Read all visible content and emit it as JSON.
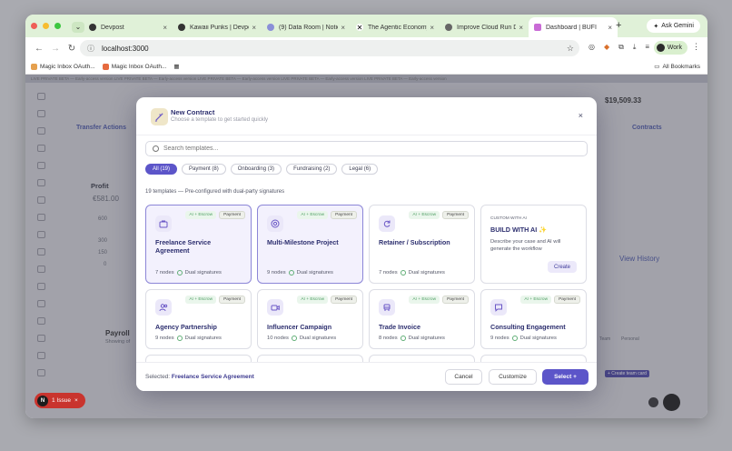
{
  "browser": {
    "tabs": [
      {
        "label": "Devpost",
        "active": false
      },
      {
        "label": "Kawaii Punks | Devpost",
        "active": false
      },
      {
        "label": "(9) Data Room | Notion",
        "active": false
      },
      {
        "label": "The Agentic Economy",
        "active": false
      },
      {
        "label": "Improve Cloud Run Dev",
        "active": false
      },
      {
        "label": "Dashboard | BUFI",
        "active": true
      }
    ],
    "ask_gemini": "Ask Gemini",
    "url": "localhost:3000",
    "profile": "Work",
    "bookmarks": [
      "Magic Inbox OAuth...",
      "Magic Inbox OAuth..."
    ],
    "all_bookmarks": "All Bookmarks"
  },
  "background": {
    "beta_banner": "LIVE PRIVATE BETA — Early-access version      LIVE PRIVATE BETA — Early-access version      LIVE PRIVATE BETA — Early-access version      LIVE PRIVATE BETA — Early-access version      LIVE PRIVATE BETA — Early-access version",
    "balance": "$19,509.33",
    "transfer_actions": "Transfer Actions",
    "contracts": "Contracts",
    "profit": "Profit",
    "profit_value": "€581.00",
    "axis": [
      "600",
      "300",
      "150",
      "0"
    ],
    "view_history": "View History",
    "payroll": "Payroll",
    "payroll_sub": "Showing of",
    "create_team_card": "+ Create team card",
    "tabs_right": [
      "Team",
      "Personal"
    ]
  },
  "modal": {
    "title": "New Contract",
    "subtitle": "Choose a template to get started quickly",
    "close": "×",
    "search_placeholder": "Search templates...",
    "filters": [
      {
        "label": "All (19)",
        "active": true
      },
      {
        "label": "Payment (8)",
        "active": false
      },
      {
        "label": "Onboarding (3)",
        "active": false
      },
      {
        "label": "Fundraising (2)",
        "active": false
      },
      {
        "label": "Legal (6)",
        "active": false
      }
    ],
    "count_note": "19 templates — Pre-configured with dual-party signatures",
    "badge_ai": "AI + Escrow",
    "templates": [
      {
        "title": "Freelance Service Agreement",
        "type": "Payment",
        "nodes": "7 nodes",
        "sig": "Dual signatures",
        "icon": "briefcase-icon",
        "selected": true
      },
      {
        "title": "Multi-Milestone Project",
        "type": "Payment",
        "nodes": "9 nodes",
        "sig": "Dual signatures",
        "icon": "target-icon",
        "selected": true
      },
      {
        "title": "Retainer / Subscription",
        "type": "Payment",
        "nodes": "7 nodes",
        "sig": "Dual signatures",
        "icon": "refresh-icon",
        "selected": false
      },
      {
        "title": "Agency Partnership",
        "type": "Payment",
        "nodes": "9 nodes",
        "sig": "Dual signatures",
        "icon": "users-icon",
        "selected": false
      },
      {
        "title": "Influencer Campaign",
        "type": "Payment",
        "nodes": "10 nodes",
        "sig": "Dual signatures",
        "icon": "video-icon",
        "selected": false
      },
      {
        "title": "Trade Invoice",
        "type": "Payment",
        "nodes": "8 nodes",
        "sig": "Dual signatures",
        "icon": "truck-icon",
        "selected": false
      },
      {
        "title": "Consulting Engagement",
        "type": "Payment",
        "nodes": "9 nodes",
        "sig": "Dual signatures",
        "icon": "message-icon",
        "selected": false
      }
    ],
    "custom": {
      "tag": "CUSTOM WITH AI",
      "title": "BUILD WITH AI ✨",
      "desc": "Describe your case and AI will generate the workflow",
      "button": "Create"
    },
    "footer": {
      "selected_prefix": "Selected:",
      "selected_value": "Freelance Service Agreement",
      "cancel": "Cancel",
      "customize": "Customize",
      "select": "Select  +"
    }
  },
  "issue_badge": {
    "n": "N",
    "label": "1 Issue",
    "close": "×"
  }
}
